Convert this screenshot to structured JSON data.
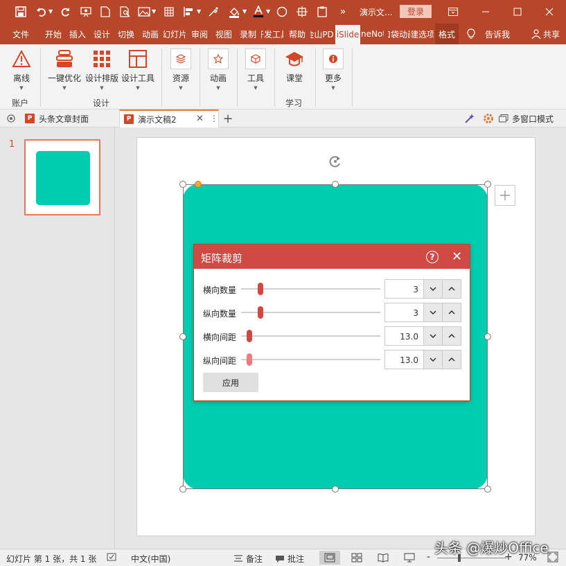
{
  "titlebar": {
    "doc_title": "演示文...",
    "login_label": "登录"
  },
  "tabs": [
    {
      "label": "文件"
    },
    {
      "label": "开始"
    },
    {
      "label": "插入"
    },
    {
      "label": "设计"
    },
    {
      "label": "切换"
    },
    {
      "label": "动画"
    },
    {
      "label": "幻灯片"
    },
    {
      "label": "审阅"
    },
    {
      "label": "视图"
    },
    {
      "label": "录制"
    },
    {
      "label": "开发工具"
    },
    {
      "label": "帮助"
    },
    {
      "label": "金山PDF"
    },
    {
      "label": "iSlide"
    },
    {
      "label": "OneNote"
    },
    {
      "label": "口袋动画"
    },
    {
      "label": "新建选项卡"
    },
    {
      "label": "格式"
    }
  ],
  "tell_me": "告诉我",
  "share": "共享",
  "ribbon": {
    "offline": "离线",
    "one_click": "一键优化",
    "layout": "设计排版",
    "design_tools": "设计工具",
    "resources": "资源",
    "animation": "动画",
    "tools": "工具",
    "classroom": "课堂",
    "more": "更多",
    "group_account": "账户",
    "group_design": "设计",
    "group_learn": "学习"
  },
  "doc_tabs": [
    {
      "label": "头条文章封面"
    },
    {
      "label": "演示文稿2"
    }
  ],
  "doc_tab_add": "+",
  "multi_window": "多窗口模式",
  "slides": [
    {
      "number": "1"
    }
  ],
  "dialog": {
    "title": "矩阵裁剪",
    "rows": [
      {
        "label": "横向数量",
        "value": "3",
        "slider_fraction": 0.12
      },
      {
        "label": "纵向数量",
        "value": "3",
        "slider_fraction": 0.12
      },
      {
        "label": "横向间距",
        "value": "13.0",
        "slider_fraction": 0.04
      },
      {
        "label": "纵向间距",
        "value": "13.0",
        "slider_fraction": 0.04
      }
    ],
    "apply_label": "应用"
  },
  "status": {
    "slide_info": "幻灯片 第 1 张，共 1 张",
    "language": "中文(中国)",
    "notes": "备注",
    "comments": "批注",
    "zoom_minus": "-",
    "zoom_plus": "+",
    "zoom": "77%"
  },
  "watermark": "头条 @爆炒Office",
  "colors": {
    "accent": "#b7472a",
    "shape_fill": "#00cdb0",
    "dialog_header": "#d04a44",
    "knob_dark": "#d04a44",
    "knob_light": "#f07c7c"
  }
}
